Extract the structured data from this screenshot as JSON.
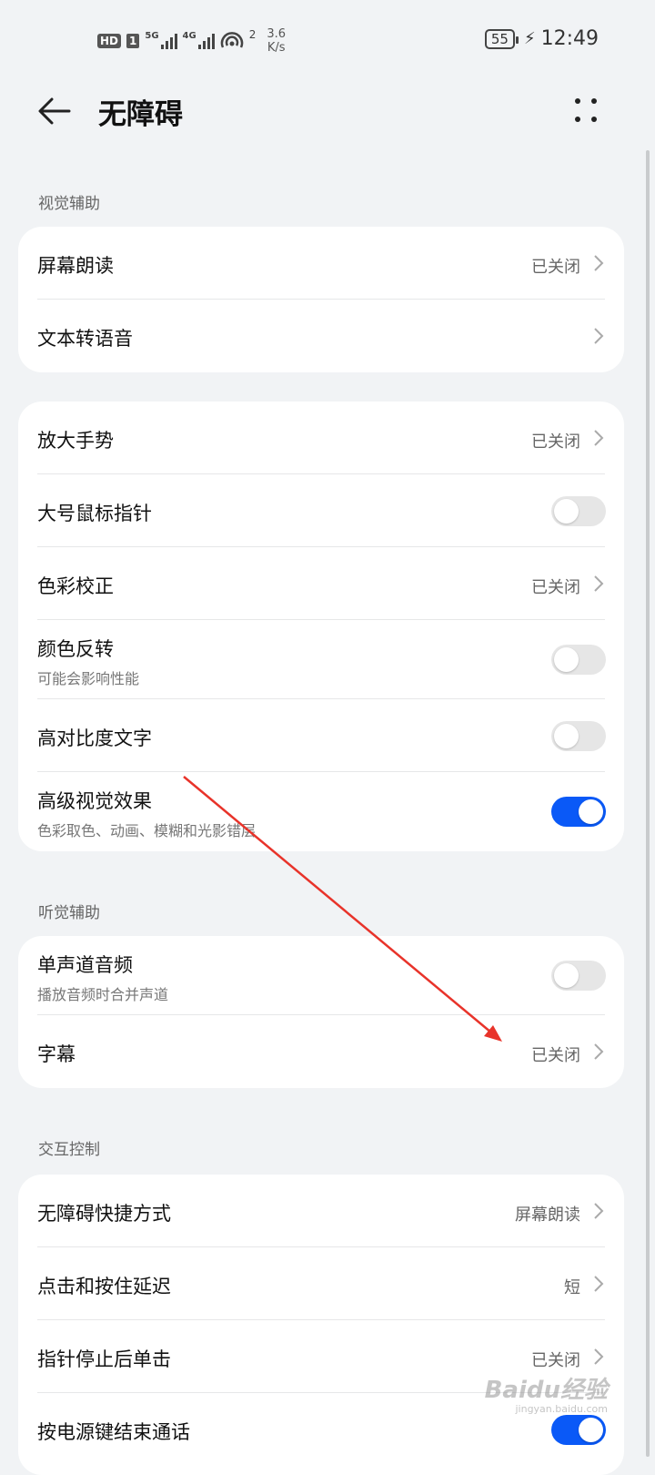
{
  "status_bar": {
    "hd": "HD",
    "sim": "1",
    "net1": "5G",
    "net2": "4G",
    "hotspot_count": "2",
    "speed_value": "3.6",
    "speed_unit": "K/s",
    "battery": "55",
    "time": "12:49"
  },
  "header": {
    "title": "无障碍",
    "back_icon": "arrow-left-icon",
    "more_icon": "more-dots-icon"
  },
  "sections": {
    "vision": {
      "label": "视觉辅助"
    },
    "hearing": {
      "label": "听觉辅助"
    },
    "interaction": {
      "label": "交互控制"
    }
  },
  "rows": {
    "screen_reader": {
      "title": "屏幕朗读",
      "value": "已关闭"
    },
    "tts": {
      "title": "文本转语音"
    },
    "magnify": {
      "title": "放大手势",
      "value": "已关闭"
    },
    "large_pointer": {
      "title": "大号鼠标指针",
      "toggle": false
    },
    "color_correction": {
      "title": "色彩校正",
      "value": "已关闭"
    },
    "color_inversion": {
      "title": "颜色反转",
      "subtitle": "可能会影响性能",
      "toggle": false
    },
    "high_contrast": {
      "title": "高对比度文字",
      "toggle": false
    },
    "advanced_visual": {
      "title": "高级视觉效果",
      "subtitle": "色彩取色、动画、模糊和光影错层",
      "toggle": true
    },
    "mono_audio": {
      "title": "单声道音频",
      "subtitle": "播放音频时合并声道",
      "toggle": false
    },
    "captions": {
      "title": "字幕",
      "value": "已关闭"
    },
    "shortcut": {
      "title": "无障碍快捷方式",
      "value": "屏幕朗读"
    },
    "touch_delay": {
      "title": "点击和按住延迟",
      "value": "短"
    },
    "dwell_click": {
      "title": "指针停止后单击",
      "value": "已关闭"
    },
    "power_end_call": {
      "title": "按电源键结束通话",
      "toggle": true
    }
  },
  "colors": {
    "accent": "#0a59f7",
    "annotation_arrow": "#e8332a",
    "background": "#f1f3f5"
  },
  "watermark": {
    "text": "Baidu经验",
    "sub": "jingyan.baidu.com"
  }
}
